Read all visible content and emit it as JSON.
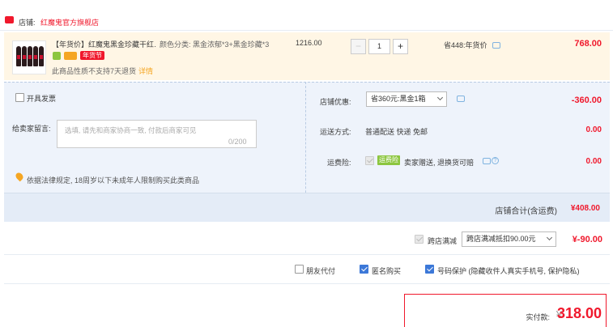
{
  "store": {
    "label": "店铺:",
    "name": "红魔鬼官方旗舰店"
  },
  "item": {
    "title": "【年货价】红魔鬼黑金珍藏干红…",
    "badge_sale": "年货节",
    "note": "此商品性质不支持7天退货",
    "note_link": "详情",
    "spec": "颜色分类: 黑金浓郁*3+黑金珍藏*3",
    "unit_price": "1216.00",
    "quantity": "1",
    "qty_minus": "−",
    "qty_plus": "+",
    "saving": "省448:年货价",
    "total": "768.00"
  },
  "options": {
    "invoice_label": "开具发票",
    "message_label": "给卖家留言:",
    "message_placeholder": "选填, 请先和商家协商一致, 付款后商家可见",
    "message_count": "0/200",
    "legal_notice": "依据法律规定, 18周岁以下未成年人限制购买此类商品",
    "discount_label": "店铺优惠:",
    "discount_select": "省360元:黑金1箱",
    "discount_value": "-360.00",
    "shipping_label": "运送方式:",
    "shipping_value": "普通配送 快递 免邮",
    "shipping_cost": "0.00",
    "insurance_label": "运费险:",
    "insurance_tag": "运费险",
    "insurance_desc": "卖家赠送, 退换货可赔",
    "insurance_cost": "0.00"
  },
  "subtotal": {
    "label": "店铺合计(含运费)",
    "value": "¥408.00"
  },
  "cross_store": {
    "label": "跨店满减",
    "select": "跨店满减抵扣90.00元",
    "value": "¥-90.00"
  },
  "extras": {
    "friend_pay": "朋友代付",
    "anonymous": "匿名购买",
    "privacy": "号码保护 (隐藏收件人真实手机号, 保护隐私)"
  },
  "final": {
    "label": "实付款:",
    "currency": "¥",
    "value": "318.00"
  },
  "colors": {
    "accent_red": "#f0182c",
    "panel_blue": "#eef3fb",
    "item_bg": "#fff6e5",
    "checkbox_blue": "#3c78d8"
  }
}
